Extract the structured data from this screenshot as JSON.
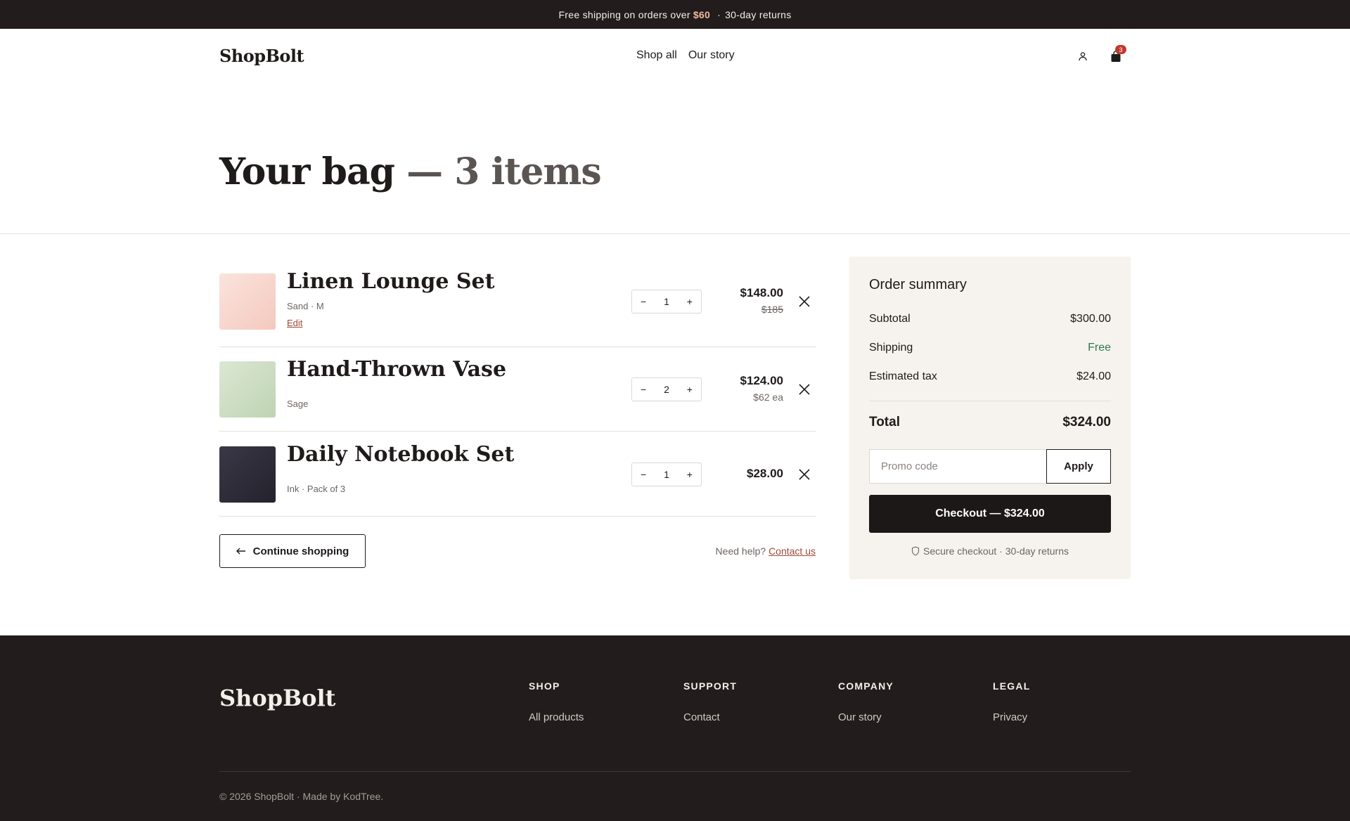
{
  "announcement": {
    "text_before": "Free shipping on orders over",
    "threshold": "$60",
    "separator": "·",
    "text_after": "30-day returns"
  },
  "header": {
    "logo": "ShopBolt",
    "nav": [
      "Shop all",
      "Our story"
    ],
    "account_icon": "user-icon",
    "cart_icon": "bag-icon",
    "cart_count": "3"
  },
  "page": {
    "title": "Your bag",
    "title_suffix": "— 3 items"
  },
  "cart": {
    "items": [
      {
        "name": "Linen Lounge Set",
        "meta": "Sand · M",
        "edit": "Edit",
        "qty": "1",
        "price": "$148.00",
        "price_sub": "$185",
        "swatch": [
          "#fbe3dd",
          "#f3c9be"
        ]
      },
      {
        "name": "Hand-Thrown Vase",
        "meta": "Sage",
        "qty": "2",
        "price": "$124.00",
        "price_sub": "$62 ea",
        "swatch": [
          "#dbe7d3",
          "#bfd3b2"
        ]
      },
      {
        "name": "Daily Notebook Set",
        "meta": "Ink · Pack of 3",
        "qty": "1",
        "price": "$28.00",
        "swatch": [
          "#3a3847",
          "#24222c"
        ]
      }
    ],
    "qty_minus": "−",
    "qty_plus": "+",
    "continue_label": "Continue shopping",
    "help_text": "Need help?",
    "help_link": "Contact us"
  },
  "summary": {
    "title": "Order summary",
    "subtotal_label": "Subtotal",
    "subtotal": "$300.00",
    "shipping_label": "Shipping",
    "shipping": "Free",
    "tax_label": "Estimated tax",
    "tax": "$24.00",
    "total_label": "Total",
    "total": "$324.00",
    "promo_placeholder": "Promo code",
    "apply_label": "Apply",
    "checkout_label": "Checkout — $324.00",
    "secure_text": "Secure checkout · 30-day returns"
  },
  "footer": {
    "logo": "ShopBolt",
    "columns": [
      {
        "heading": "SHOP",
        "link": "All products"
      },
      {
        "heading": "SUPPORT",
        "link": "Contact"
      },
      {
        "heading": "COMPANY",
        "link": "Our story"
      },
      {
        "heading": "LEGAL",
        "link": "Privacy"
      }
    ],
    "copyright": "© 2026 ShopBolt · Made by KodTree."
  },
  "colors": {
    "dark": "#221d1c",
    "accent_link": "#9d4b3a",
    "free_green": "#2f7a4e",
    "summary_bg": "#f6f3ee",
    "badge": "#c0392b"
  }
}
